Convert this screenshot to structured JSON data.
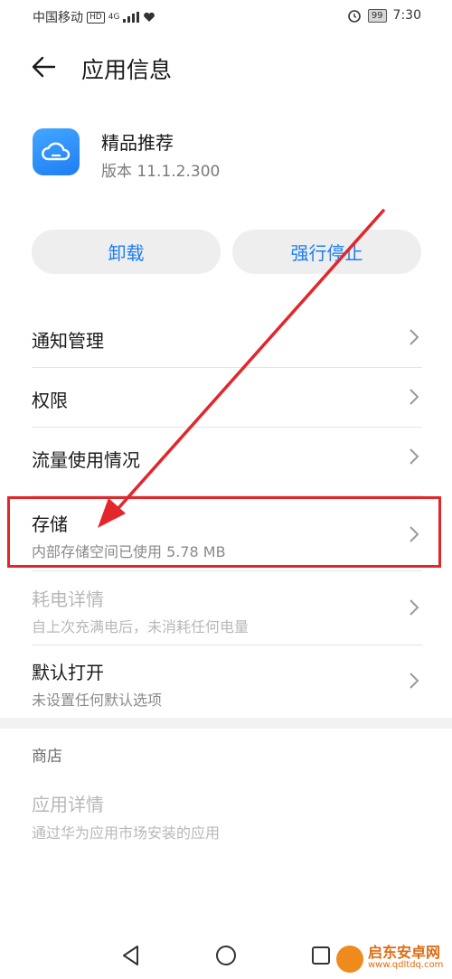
{
  "status_bar": {
    "carrier": "中国移动",
    "hd_badge": "HD",
    "network": "4G",
    "battery": "99",
    "time": "7:30"
  },
  "header": {
    "title": "应用信息",
    "back_icon": "arrow-left-icon"
  },
  "app": {
    "name": "精品推荐",
    "version": "版本 11.1.2.300",
    "icon": "cloud-icon"
  },
  "actions": {
    "uninstall": "卸载",
    "force_stop": "强行停止"
  },
  "settings": [
    {
      "title": "通知管理",
      "subtitle": ""
    },
    {
      "title": "权限",
      "subtitle": ""
    },
    {
      "title": "流量使用情况",
      "subtitle": ""
    },
    {
      "title": "存储",
      "subtitle": "内部存储空间已使用 5.78 MB"
    },
    {
      "title": "耗电详情",
      "subtitle": "自上次充满电后，未消耗任何电量"
    },
    {
      "title": "默认打开",
      "subtitle": "未设置任何默认选项"
    }
  ],
  "store": {
    "section_label": "商店",
    "title": "应用详情",
    "subtitle": "通过华为应用市场安装的应用"
  },
  "watermark": {
    "name": "启东安卓网",
    "url": "www.qdltdq.com"
  },
  "colors": {
    "accent": "#1c7df3",
    "annotation": "#e3262b",
    "button_bg": "#eeeeee"
  }
}
